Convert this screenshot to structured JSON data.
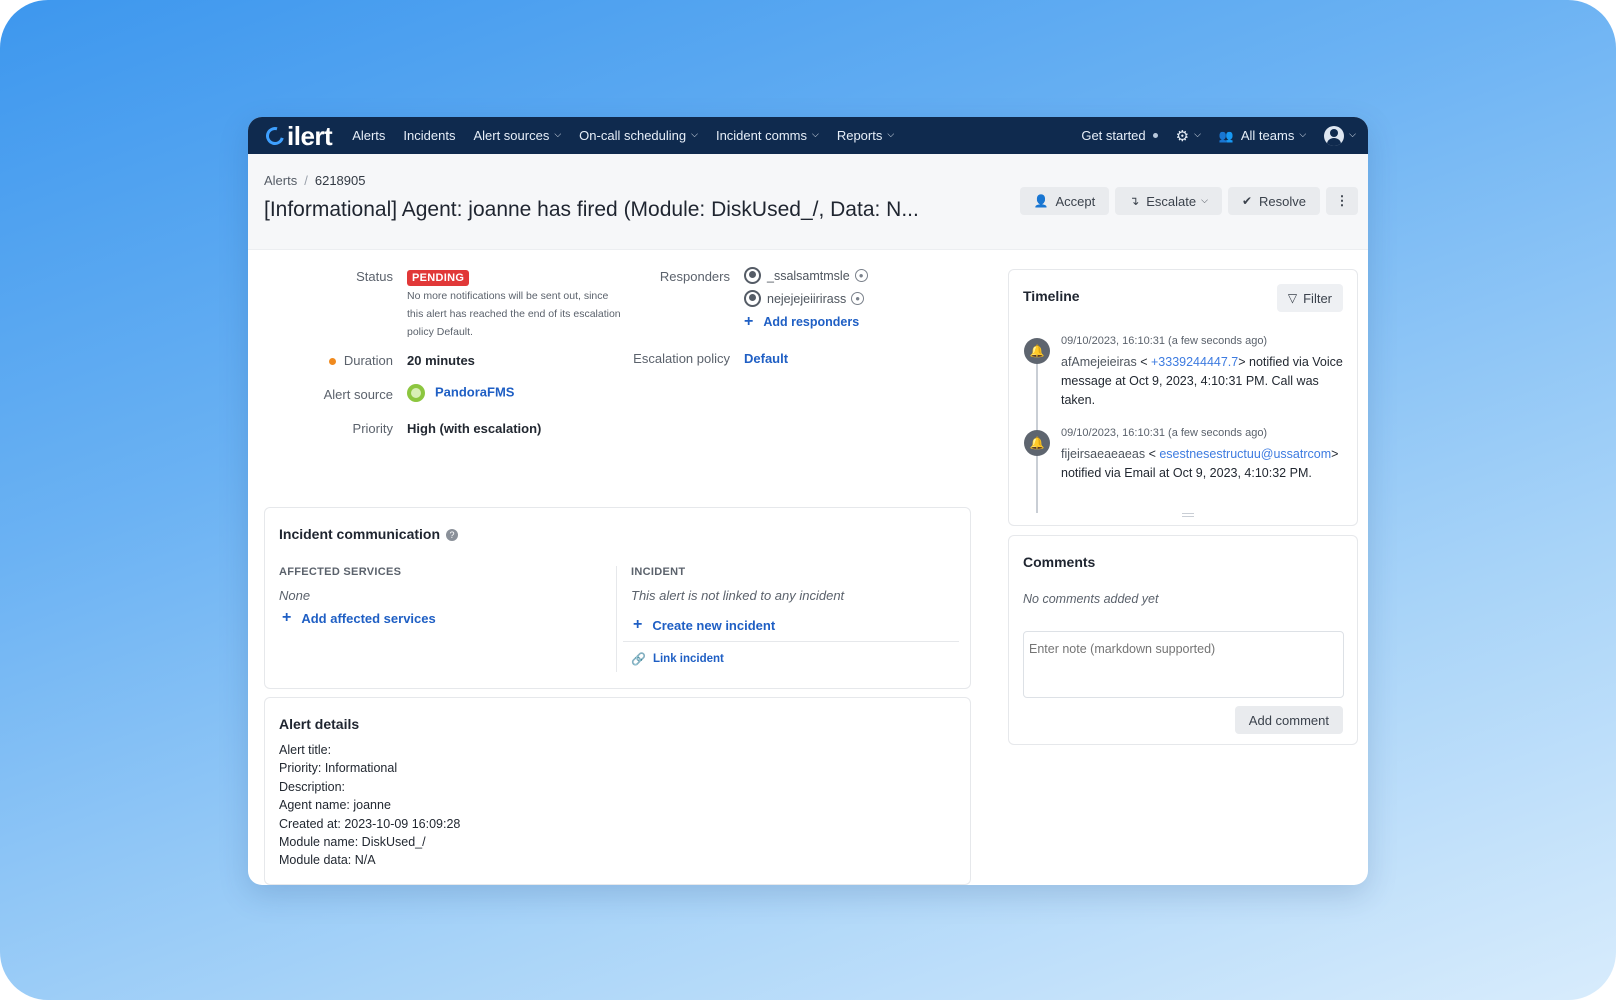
{
  "nav": {
    "logo": "ilert",
    "items": [
      {
        "label": "Alerts",
        "dropdown": false
      },
      {
        "label": "Incidents",
        "dropdown": false
      },
      {
        "label": "Alert sources",
        "dropdown": true
      },
      {
        "label": "On-call scheduling",
        "dropdown": true
      },
      {
        "label": "Incident comms",
        "dropdown": true
      },
      {
        "label": "Reports",
        "dropdown": true
      }
    ],
    "get_started": "Get started",
    "teams": "All teams"
  },
  "header": {
    "breadcrumb_root": "Alerts",
    "breadcrumb_id": "6218905",
    "title": "[Informational] Agent: joanne has fired (Module: DiskUsed_/, Data: N...",
    "accept": "Accept",
    "escalate": "Escalate",
    "resolve": "Resolve"
  },
  "summary": {
    "status_label": "Status",
    "status_badge": "PENDING",
    "status_note": "No more notifications will be sent out, since this alert has reached the end of its escalation policy Default.",
    "duration_label": "Duration",
    "duration_value": "20 minutes",
    "alert_source_label": "Alert source",
    "alert_source_value": "PandoraFMS",
    "priority_label": "Priority",
    "priority_value": "High (with escalation)",
    "responders_label": "Responders",
    "responders": [
      "_ssalsamtmsle",
      "nejejejeiirirass"
    ],
    "add_responders": "Add responders",
    "escalation_label": "Escalation policy",
    "escalation_value": "Default"
  },
  "incident_comm": {
    "title": "Incident communication",
    "affected_head": "AFFECTED SERVICES",
    "affected_value": "None",
    "add_affected": "Add affected services",
    "incident_head": "INCIDENT",
    "incident_value": "This alert is not linked to any incident",
    "create_incident": "Create new incident",
    "link_incident": "Link incident"
  },
  "alert_details": {
    "title": "Alert details",
    "lines": [
      "Alert title:",
      "Priority: Informational",
      "Description:",
      "Agent name: joanne",
      "Created at: 2023-10-09 16:09:28",
      "Module name: DiskUsed_/",
      "Module data: N/A"
    ]
  },
  "timeline": {
    "title": "Timeline",
    "filter": "Filter",
    "entries": [
      {
        "time": "09/10/2023, 16:10:31 (a few seconds ago)",
        "name": "afAmejeieiras",
        "contact": "+3339244447.7",
        "text_pre": " < ",
        "text_mid": "> notified via Voice message at Oct 9, 2023, 4:10:31 PM. Call was taken."
      },
      {
        "time": "09/10/2023, 16:10:31 (a few seconds ago)",
        "name": "fijeirsaeaeaeas",
        "contact": "esestnesestructuu@ussatrcom",
        "text_pre": " < ",
        "text_mid": "> notified via Email at Oct 9, 2023, 4:10:32 PM."
      }
    ]
  },
  "comments": {
    "title": "Comments",
    "empty": "No comments added yet",
    "placeholder": "Enter note (markdown supported)",
    "add_button": "Add comment"
  }
}
